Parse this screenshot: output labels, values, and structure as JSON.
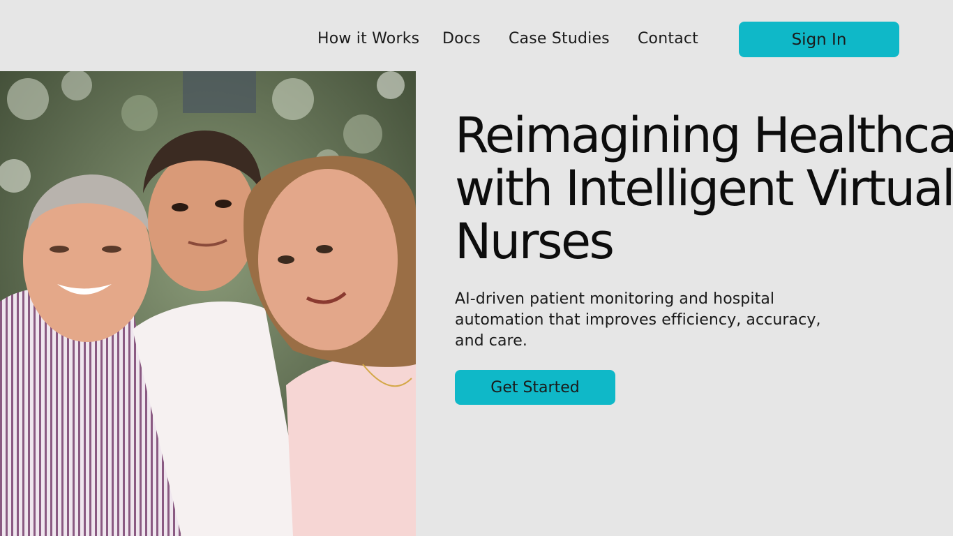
{
  "nav": {
    "links": [
      "How it Works",
      "Docs",
      "Case Studies",
      "Contact"
    ],
    "signin_label": "Sign In"
  },
  "hero": {
    "headline_lines": [
      "Reimagining Healthcare",
      "with Intelligent Virtual",
      "Nurses"
    ],
    "subtext_lines": [
      "AI-driven patient monitoring and hospital",
      "automation that improves efficiency, accuracy,",
      "and care."
    ],
    "cta_label": "Get Started"
  },
  "colors": {
    "background": "#e6e6e6",
    "accent": "#0fb8c8",
    "text": "#111111"
  }
}
